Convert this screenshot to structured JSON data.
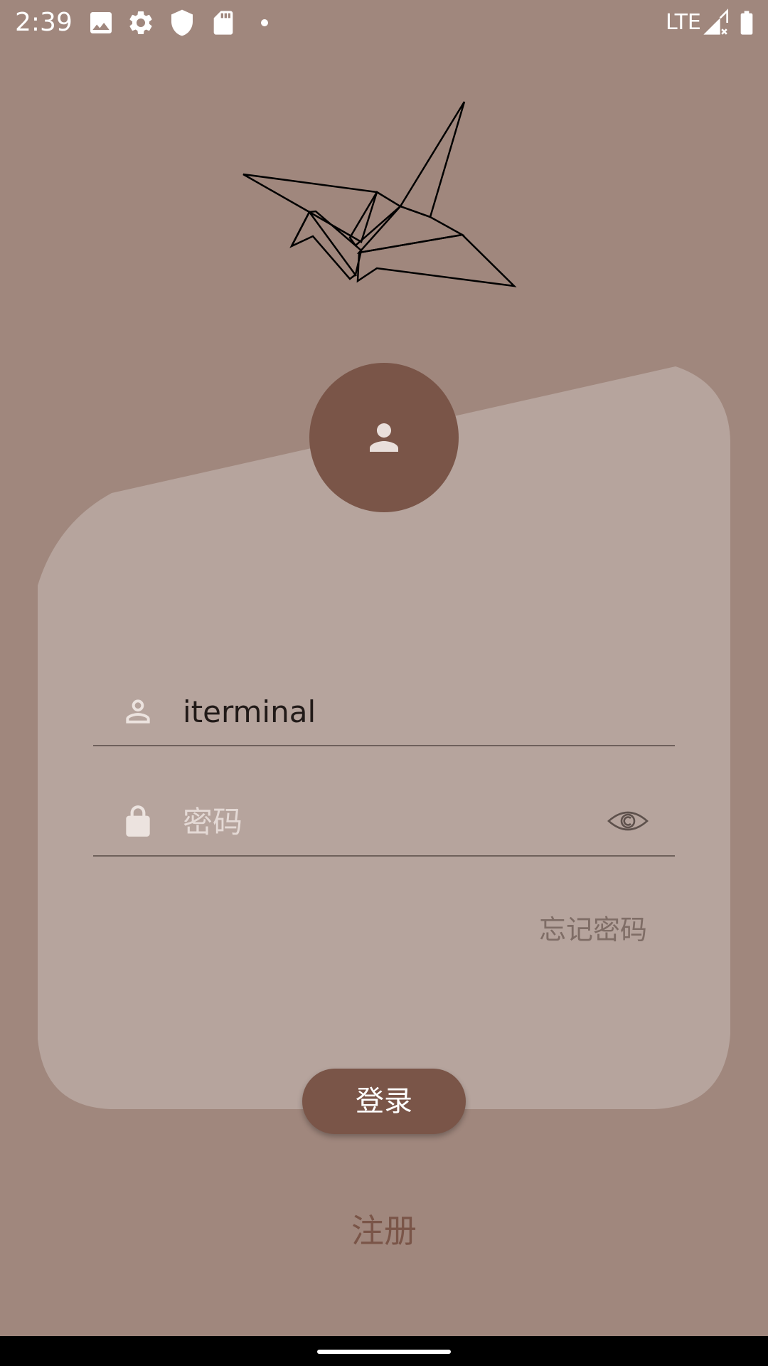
{
  "status_bar": {
    "time": "2:39",
    "network": "LTE",
    "icons": [
      "image-icon",
      "gear-icon",
      "shield-icon",
      "sd-card-icon",
      "dot-icon",
      "signal-icon",
      "battery-icon"
    ]
  },
  "login": {
    "username_value": "iterminal",
    "password_placeholder": "密码",
    "forgot_password": "忘记密码",
    "login_button": "登录",
    "register_link": "注册"
  },
  "colors": {
    "background": "#a0877d",
    "card": "#b6a49d",
    "accent": "#7a5548"
  }
}
